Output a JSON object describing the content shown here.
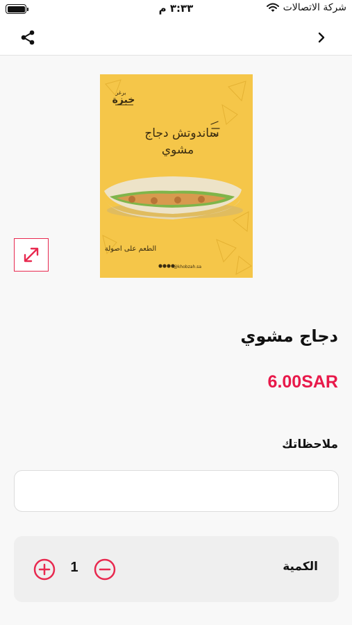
{
  "status_bar": {
    "carrier": "شركة الاتصالات",
    "time": "٣:٣٣ م"
  },
  "poster": {
    "title_line1": "ساندوتش دجاج",
    "title_line2": "مشوي",
    "brand": "خبزة",
    "tagline": "الطعم على اصولة",
    "handle": "@khobzah.sa",
    "background_color": "#f5c649"
  },
  "product": {
    "name": "دجاج مشوي",
    "price": "6.00SAR",
    "price_color": "#e8194a"
  },
  "notes": {
    "label": "ملاحظاتك",
    "value": "",
    "placeholder": ""
  },
  "quantity": {
    "label": "الكمية",
    "value": "1"
  },
  "icons": {
    "share": "share-icon",
    "back": "chevron-right-icon",
    "expand": "expand-icon",
    "plus": "plus-circle-icon",
    "minus": "minus-circle-icon"
  },
  "accent_color": "#e8294f"
}
